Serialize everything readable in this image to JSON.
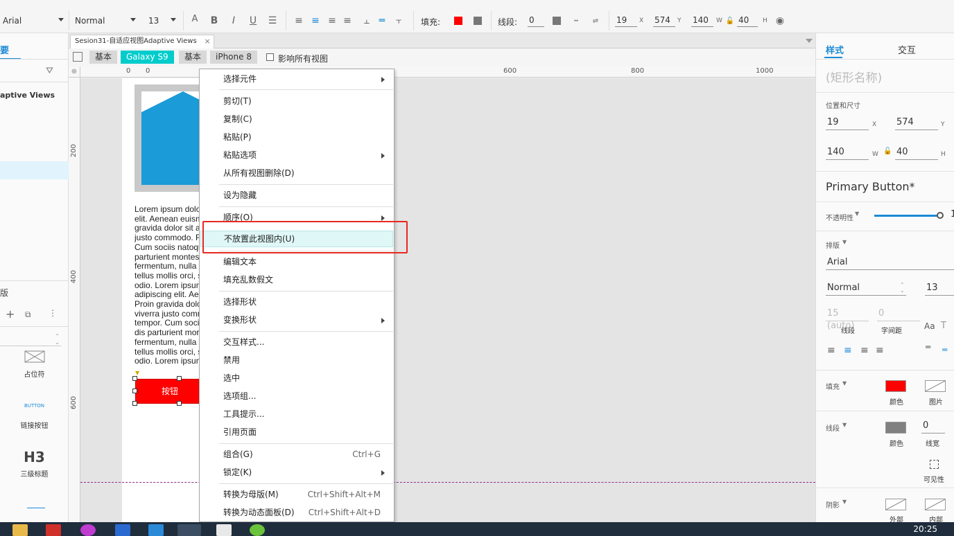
{
  "toolbar": {
    "font_family": "Arial",
    "font_style": "Normal",
    "font_size": "13",
    "fill_label": "填充:",
    "stroke_label": "线段:",
    "stroke_value": "0",
    "x": "19",
    "y": "574",
    "w": "140",
    "h": "40",
    "unit_x": "X",
    "unit_y": "Y",
    "unit_w": "W",
    "unit_h": "H",
    "fill_color": "#ff0000"
  },
  "left_panel": {
    "tab_fragment": "要",
    "page_title_fragment": "aptive Views",
    "section_fragment": "版",
    "lib_items": [
      {
        "label": "占位符"
      },
      {
        "label": "链接按钮",
        "preview": "BUTTON"
      },
      {
        "label": "三级标题",
        "preview": "H3"
      }
    ]
  },
  "doc_tab": {
    "title": "Sesion31-自适应视图Adaptive Views",
    "close": "×"
  },
  "views": {
    "base1": "基本",
    "galaxy": "Galaxy S9",
    "base2": "基本",
    "iphone": "iPhone 8",
    "affect_all": "影响所有视图"
  },
  "ruler": {
    "h_labels": [
      "0",
      "0",
      "600",
      "800",
      "1000"
    ],
    "v_labels": [
      "200",
      "400",
      "600"
    ]
  },
  "canvas": {
    "lorem": "Lorem ipsum dolo\nelit. Aenean euism\ngravida dolor sit a\njusto commodo. F\nCum sociis natoqu\nparturient montes\nfermentum, nulla l\ntellus mollis orci, s\nodio. Lorem ipsun\nadipiscing elit. Ae\nProin gravida dolo\nviverra justo comr\ntempor. Cum soci\ndis parturient mor\nfermentum, nulla l\ntellus mollis orci, s\nodio. Lorem ipsun",
    "button_label": "按钮"
  },
  "context_menu": {
    "items": [
      {
        "label": "选择元件",
        "submenu": true
      },
      {
        "label": "剪切(T)"
      },
      {
        "label": "复制(C)"
      },
      {
        "label": "粘贴(P)"
      },
      {
        "label": "粘贴选项",
        "submenu": true
      },
      {
        "label": "从所有视图删除(D)"
      },
      {
        "label": "设为隐藏"
      },
      {
        "label": "顺序(O)",
        "submenu": true
      },
      {
        "label": "不放置此视图内(U)"
      },
      {
        "label": "编辑文本"
      },
      {
        "label": "填充乱数假文"
      },
      {
        "label": "选择形状"
      },
      {
        "label": "变换形状",
        "submenu": true
      },
      {
        "label": "交互样式..."
      },
      {
        "label": "禁用"
      },
      {
        "label": "选中"
      },
      {
        "label": "选项组..."
      },
      {
        "label": "工具提示..."
      },
      {
        "label": "引用页面"
      },
      {
        "label": "组合(G)",
        "shortcut": "Ctrl+G"
      },
      {
        "label": "锁定(K)",
        "submenu": true
      },
      {
        "label": "转换为母版(M)",
        "shortcut": "Ctrl+Shift+Alt+M"
      },
      {
        "label": "转换为动态面板(D)",
        "shortcut": "Ctrl+Shift+Alt+D"
      }
    ]
  },
  "right_panel": {
    "tab_style": "样式",
    "tab_interact": "交互",
    "shape_name_placeholder": "(矩形名称)",
    "pos_size_label": "位置和尺寸",
    "x": "19",
    "y": "574",
    "w": "140",
    "h": "40",
    "unit_x": "X",
    "unit_y": "Y",
    "unit_w": "W",
    "unit_h": "H",
    "style_name": "Primary Button*",
    "opacity_label": "不透明性",
    "opacity_fragment": "1",
    "typography_label": "排版",
    "font": "Arial",
    "font_style": "Normal",
    "font_size": "13",
    "line_height": "15 (auto)",
    "letter_spacing": "0",
    "line_height_label": "线段",
    "letter_spacing_label": "字间距",
    "fill_label": "填充",
    "fill_color_label": "颜色",
    "fill_image_label": "图片",
    "stroke_label": "线段",
    "stroke_color_label": "颜色",
    "stroke_width": "0",
    "stroke_width_label": "线宽",
    "visibility_label": "可见性",
    "shadow_label": "阴影",
    "shadow_outer": "外部",
    "shadow_inner": "内部",
    "fill_color": "#ff0000",
    "stroke_color": "#808080"
  },
  "taskbar": {
    "time": "20:25"
  }
}
